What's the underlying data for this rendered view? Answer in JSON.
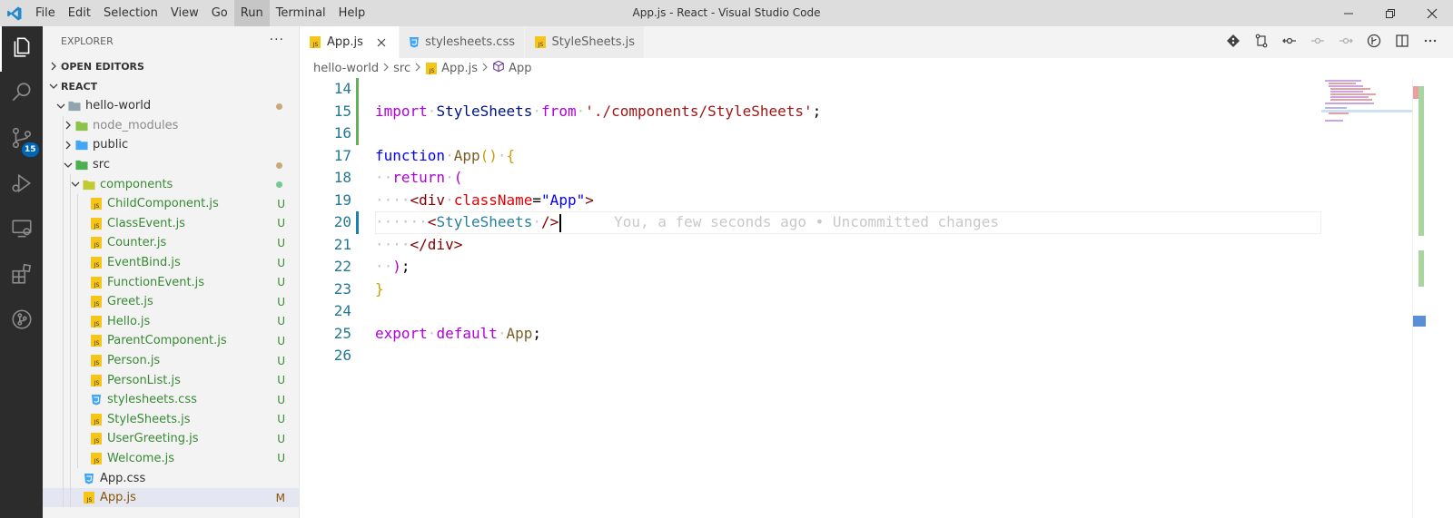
{
  "titlebar": {
    "menu": [
      "File",
      "Edit",
      "Selection",
      "View",
      "Go",
      "Run",
      "Terminal",
      "Help"
    ],
    "active_menu": "Run",
    "window_title": "App.js - React - Visual Studio Code"
  },
  "activity": {
    "source_control_badge": "15"
  },
  "sidebar": {
    "header": "EXPLORER",
    "more": "···",
    "open_editors": "OPEN EDITORS",
    "workspace": "REACT",
    "tree": [
      {
        "label": "hello-world",
        "type": "folder-open",
        "depth": 0,
        "status": "dot-brown"
      },
      {
        "label": "node_modules",
        "type": "folder-node",
        "depth": 1,
        "status": "",
        "dim": true
      },
      {
        "label": "public",
        "type": "folder-public",
        "depth": 1,
        "status": ""
      },
      {
        "label": "src",
        "type": "folder-src",
        "depth": 1,
        "status": "dot-brown"
      },
      {
        "label": "components",
        "type": "folder-comp",
        "depth": 2,
        "status": "dot-green",
        "green": true
      },
      {
        "label": "ChildComponent.js",
        "type": "js",
        "depth": 3,
        "status": "U",
        "green": true
      },
      {
        "label": "ClassEvent.js",
        "type": "js",
        "depth": 3,
        "status": "U",
        "green": true
      },
      {
        "label": "Counter.js",
        "type": "js",
        "depth": 3,
        "status": "U",
        "green": true
      },
      {
        "label": "EventBind.js",
        "type": "js",
        "depth": 3,
        "status": "U",
        "green": true
      },
      {
        "label": "FunctionEvent.js",
        "type": "js",
        "depth": 3,
        "status": "U",
        "green": true
      },
      {
        "label": "Greet.js",
        "type": "js",
        "depth": 3,
        "status": "U",
        "green": true
      },
      {
        "label": "Hello.js",
        "type": "js",
        "depth": 3,
        "status": "U",
        "green": true
      },
      {
        "label": "ParentComponent.js",
        "type": "js",
        "depth": 3,
        "status": "U",
        "green": true
      },
      {
        "label": "Person.js",
        "type": "js",
        "depth": 3,
        "status": "U",
        "green": true
      },
      {
        "label": "PersonList.js",
        "type": "js",
        "depth": 3,
        "status": "U",
        "green": true
      },
      {
        "label": "stylesheets.css",
        "type": "css",
        "depth": 3,
        "status": "U",
        "green": true
      },
      {
        "label": "StyleSheets.js",
        "type": "js",
        "depth": 3,
        "status": "U",
        "green": true
      },
      {
        "label": "UserGreeting.js",
        "type": "js",
        "depth": 3,
        "status": "U",
        "green": true
      },
      {
        "label": "Welcome.js",
        "type": "js",
        "depth": 3,
        "status": "U",
        "green": true
      },
      {
        "label": "App.css",
        "type": "css",
        "depth": 2,
        "status": ""
      },
      {
        "label": "App.js",
        "type": "js",
        "depth": 2,
        "status": "M",
        "selected": true
      }
    ]
  },
  "tabs": [
    {
      "label": "App.js",
      "type": "js",
      "active": true
    },
    {
      "label": "stylesheets.css",
      "type": "css",
      "active": false
    },
    {
      "label": "StyleSheets.js",
      "type": "js",
      "active": false
    }
  ],
  "breadcrumb": [
    "hello-world",
    "src",
    "App.js",
    "App"
  ],
  "code": {
    "line_numbers": [
      "14",
      "15",
      "16",
      "17",
      "18",
      "19",
      "20",
      "21",
      "22",
      "23",
      "24",
      "25",
      "26"
    ],
    "blame": "You, a few seconds ago • Uncommitted changes"
  },
  "colors": {
    "accent": "#007acc",
    "added": "#388a34",
    "modified": "#b08b56"
  }
}
